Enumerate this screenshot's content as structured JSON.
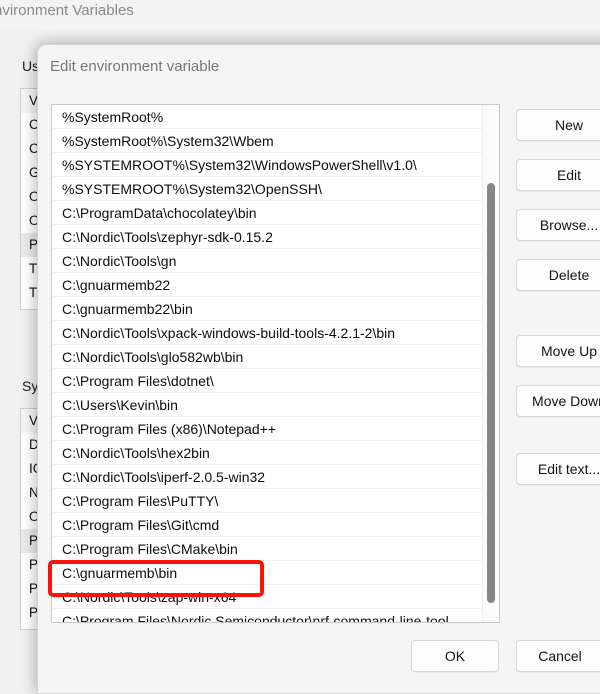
{
  "background_window": {
    "title": "nvironment Variables",
    "user_section_label": "User",
    "system_section_label": "Syste",
    "user_rows": [
      "Var",
      "CH",
      "Ch",
      "GN",
      "On",
      "On",
      "Pat",
      "TEI",
      "TM"
    ],
    "system_rows": [
      "Var",
      "Dri",
      "IGC",
      "NU",
      "OS",
      "Pat",
      "PA",
      "PR",
      "PR"
    ]
  },
  "dialog": {
    "title": "Edit environment variable",
    "paths": [
      "%SystemRoot%",
      "%SystemRoot%\\System32\\Wbem",
      "%SYSTEMROOT%\\System32\\WindowsPowerShell\\v1.0\\",
      "%SYSTEMROOT%\\System32\\OpenSSH\\",
      "C:\\ProgramData\\chocolatey\\bin",
      "C:\\Nordic\\Tools\\zephyr-sdk-0.15.2",
      "C:\\Nordic\\Tools\\gn",
      "C:\\gnuarmemb22",
      "C:\\gnuarmemb22\\bin",
      "C:\\Nordic\\Tools\\xpack-windows-build-tools-4.2.1-2\\bin",
      "C:\\Nordic\\Tools\\glo582wb\\bin",
      "C:\\Program Files\\dotnet\\",
      "C:\\Users\\Kevin\\bin",
      "C:\\Program Files (x86)\\Notepad++",
      "C:\\Nordic\\Tools\\hex2bin",
      "C:\\Nordic\\Tools\\iperf-2.0.5-win32",
      "C:\\Program Files\\PuTTY\\",
      "C:\\Program Files\\Git\\cmd",
      "C:\\Program Files\\CMake\\bin",
      "C:\\gnuarmemb\\bin",
      "C:\\Nordic\\Tools\\zap-win-x64",
      "C:\\Program Files\\Nordic Semiconductor\\nrf-command-line-tool..."
    ],
    "buttons": {
      "new": "New",
      "edit": "Edit",
      "browse": "Browse...",
      "delete": "Delete",
      "move_up": "Move Up",
      "move_down": "Move Down",
      "edit_text": "Edit text...",
      "ok": "OK",
      "cancel": "Cancel"
    }
  },
  "annotation": {
    "highlight_color": "#fa1408",
    "highlighted_path": "C:\\Nordic\\Tools\\zap-win-x64"
  }
}
